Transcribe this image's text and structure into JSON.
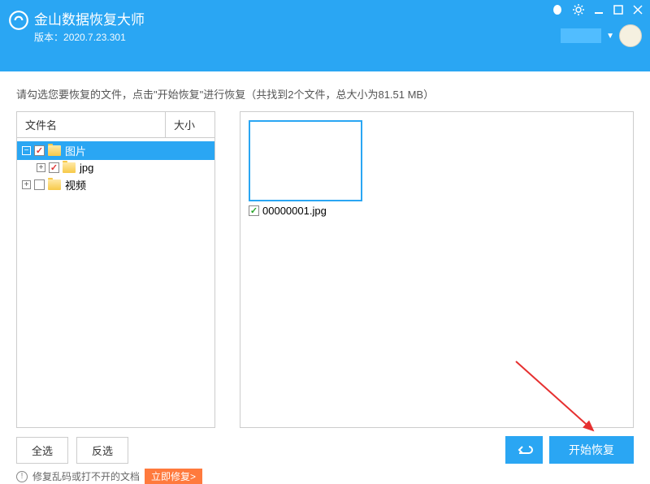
{
  "header": {
    "title": "金山数据恢复大师",
    "version_label": "版本：",
    "version": "2020.7.23.301"
  },
  "instruction": "请勾选您要恢复的文件，点击\"开始恢复\"进行恢复（共找到2个文件，总大小为81.51 MB）",
  "tree": {
    "columns": {
      "name": "文件名",
      "size": "大小"
    },
    "items": [
      {
        "label": "图片",
        "checked": true,
        "expanded": true,
        "selected": true,
        "level": 0
      },
      {
        "label": "jpg",
        "checked": true,
        "expanded": false,
        "selected": false,
        "level": 1
      },
      {
        "label": "视频",
        "checked": false,
        "expanded": false,
        "selected": false,
        "level": 0
      }
    ]
  },
  "preview": {
    "files": [
      {
        "name": "00000001.jpg",
        "checked": true
      }
    ]
  },
  "footer": {
    "select_all": "全选",
    "invert_selection": "反选",
    "start_recover": "开始恢复",
    "garbled_hint": "修复乱码或打不开的文档",
    "fix_now": "立即修复>"
  }
}
